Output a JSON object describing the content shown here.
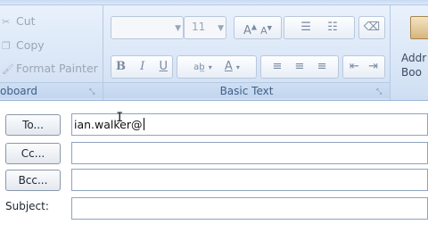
{
  "ribbon": {
    "clipboard": {
      "items": [
        {
          "icon": "scissors-icon",
          "label": "Cut"
        },
        {
          "icon": "copy-icon",
          "label": "Copy"
        },
        {
          "icon": "format-painter-icon",
          "label": "Format Painter"
        }
      ],
      "group_label": "oboard"
    },
    "basic_text": {
      "font_name": "",
      "font_size": "11",
      "bold": "B",
      "italic": "I",
      "underline": "U",
      "group_label": "Basic Text"
    },
    "names": {
      "address_book_label_1": "Addr",
      "address_book_label_2": "Boo"
    }
  },
  "header": {
    "to_button": "To...",
    "to_value": "ian.walker@",
    "cc_button": "Cc...",
    "cc_value": "",
    "bcc_button": "Bcc...",
    "bcc_value": "",
    "subject_label": "Subject:",
    "subject_value": ""
  }
}
